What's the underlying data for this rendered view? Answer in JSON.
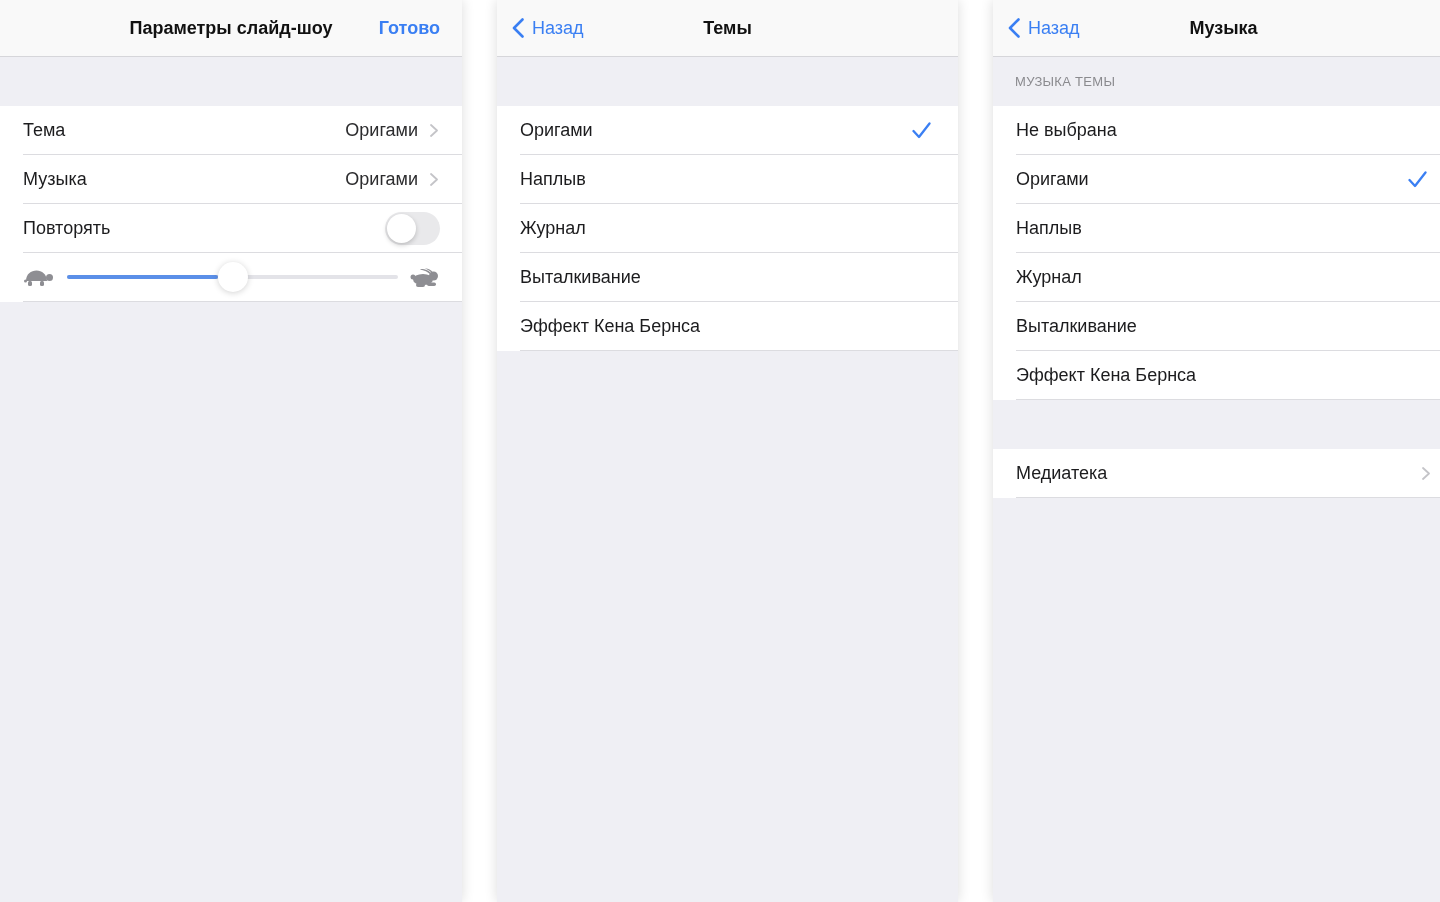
{
  "panels": [
    {
      "nav": {
        "title": "Параметры слайд-шоу",
        "done": "Готово"
      },
      "sections": [
        {
          "rows": [
            {
              "kind": "disclosure",
              "label": "Тема",
              "value": "Оригами"
            },
            {
              "kind": "disclosure",
              "label": "Музыка",
              "value": "Оригами"
            },
            {
              "kind": "toggle",
              "label": "Повторять",
              "on": false
            },
            {
              "kind": "slider",
              "level": 0.5
            }
          ]
        }
      ]
    },
    {
      "nav": {
        "back": "Назад",
        "title": "Темы"
      },
      "sections": [
        {
          "rows": [
            {
              "kind": "option",
              "label": "Оригами",
              "selected": true
            },
            {
              "kind": "option",
              "label": "Наплыв",
              "selected": false
            },
            {
              "kind": "option",
              "label": "Журнал",
              "selected": false
            },
            {
              "kind": "option",
              "label": "Выталкивание",
              "selected": false
            },
            {
              "kind": "option",
              "label": "Эффект Кена Бернса",
              "selected": false
            }
          ]
        }
      ]
    },
    {
      "nav": {
        "back": "Назад",
        "title": "Музыка"
      },
      "sections": [
        {
          "header": "МУЗЫКА ТЕМЫ",
          "rows": [
            {
              "kind": "option",
              "label": "Не выбрана",
              "selected": false
            },
            {
              "kind": "option",
              "label": "Оригами",
              "selected": true
            },
            {
              "kind": "option",
              "label": "Наплыв",
              "selected": false
            },
            {
              "kind": "option",
              "label": "Журнал",
              "selected": false
            },
            {
              "kind": "option",
              "label": "Выталкивание",
              "selected": false
            },
            {
              "kind": "option",
              "label": "Эффект Кена Бернса",
              "selected": false
            }
          ]
        },
        {
          "rows": [
            {
              "kind": "disclosure",
              "label": "Медиатека"
            }
          ]
        }
      ]
    }
  ]
}
